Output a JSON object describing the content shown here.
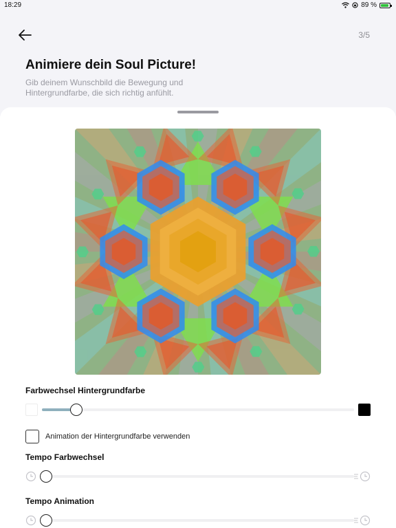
{
  "status": {
    "time": "18:29",
    "battery_text": "89 %",
    "battery_level": 0.89
  },
  "header": {
    "step": "3/5"
  },
  "title": "Animiere dein Soul Picture!",
  "subtitle": "Gib deinem Wunschbild die Bewegung und Hintergrundfarbe, die sich richtig anfühlt.",
  "controls": {
    "bg_color": {
      "label": "Farbwechsel Hintergrundfarbe",
      "value": 0.1
    },
    "use_bg_animation": {
      "label": "Animation der Hintergrundfarbe verwenden",
      "checked": false
    },
    "color_tempo": {
      "label": "Tempo Farbwechsel",
      "value": 0.0
    },
    "animation_tempo": {
      "label": "Tempo Animation",
      "value": 0.0
    }
  },
  "colors": {
    "accent": "#8fb0bd",
    "sheet": "#ffffff",
    "background": "#f4f4f8"
  }
}
